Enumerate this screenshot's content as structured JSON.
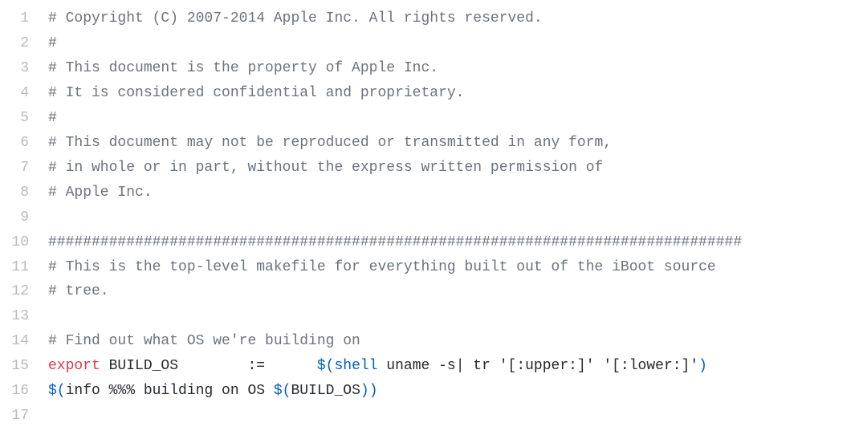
{
  "lines": [
    {
      "n": 1,
      "tokens": [
        {
          "cls": "tok-cmt",
          "text": "# Copyright (C) 2007-2014 Apple Inc. All rights reserved."
        }
      ]
    },
    {
      "n": 2,
      "tokens": [
        {
          "cls": "tok-cmt",
          "text": "#"
        }
      ]
    },
    {
      "n": 3,
      "tokens": [
        {
          "cls": "tok-cmt",
          "text": "# This document is the property of Apple Inc."
        }
      ]
    },
    {
      "n": 4,
      "tokens": [
        {
          "cls": "tok-cmt",
          "text": "# It is considered confidential and proprietary."
        }
      ]
    },
    {
      "n": 5,
      "tokens": [
        {
          "cls": "tok-cmt",
          "text": "#"
        }
      ]
    },
    {
      "n": 6,
      "tokens": [
        {
          "cls": "tok-cmt",
          "text": "# This document may not be reproduced or transmitted in any form,"
        }
      ]
    },
    {
      "n": 7,
      "tokens": [
        {
          "cls": "tok-cmt",
          "text": "# in whole or in part, without the express written permission of"
        }
      ]
    },
    {
      "n": 8,
      "tokens": [
        {
          "cls": "tok-cmt",
          "text": "# Apple Inc."
        }
      ]
    },
    {
      "n": 9,
      "tokens": []
    },
    {
      "n": 10,
      "tokens": [
        {
          "cls": "tok-cmt",
          "text": "################################################################################"
        }
      ]
    },
    {
      "n": 11,
      "tokens": [
        {
          "cls": "tok-cmt",
          "text": "# This is the top-level makefile for everything built out of the iBoot source"
        }
      ]
    },
    {
      "n": 12,
      "tokens": [
        {
          "cls": "tok-cmt",
          "text": "# tree."
        }
      ]
    },
    {
      "n": 13,
      "tokens": []
    },
    {
      "n": 14,
      "tokens": [
        {
          "cls": "tok-cmt",
          "text": "# Find out what OS we're building on"
        }
      ]
    },
    {
      "n": 15,
      "tokens": [
        {
          "cls": "tok-kw",
          "text": "export"
        },
        {
          "cls": "tok-txt",
          "text": " BUILD_OS        :=      "
        },
        {
          "cls": "tok-fn",
          "text": "$("
        },
        {
          "cls": "tok-fn",
          "text": "shell"
        },
        {
          "cls": "tok-txt",
          "text": " uname -s| tr '[:upper:]' '[:lower:]'"
        },
        {
          "cls": "tok-fn",
          "text": ")"
        }
      ]
    },
    {
      "n": 16,
      "tokens": [
        {
          "cls": "tok-fn",
          "text": "$("
        },
        {
          "cls": "tok-txt",
          "text": "info %%% building on OS "
        },
        {
          "cls": "tok-fn",
          "text": "$("
        },
        {
          "cls": "tok-txt",
          "text": "BUILD_OS"
        },
        {
          "cls": "tok-fn",
          "text": ")"
        },
        {
          "cls": "tok-fn",
          "text": ")"
        }
      ]
    },
    {
      "n": 17,
      "tokens": []
    }
  ]
}
